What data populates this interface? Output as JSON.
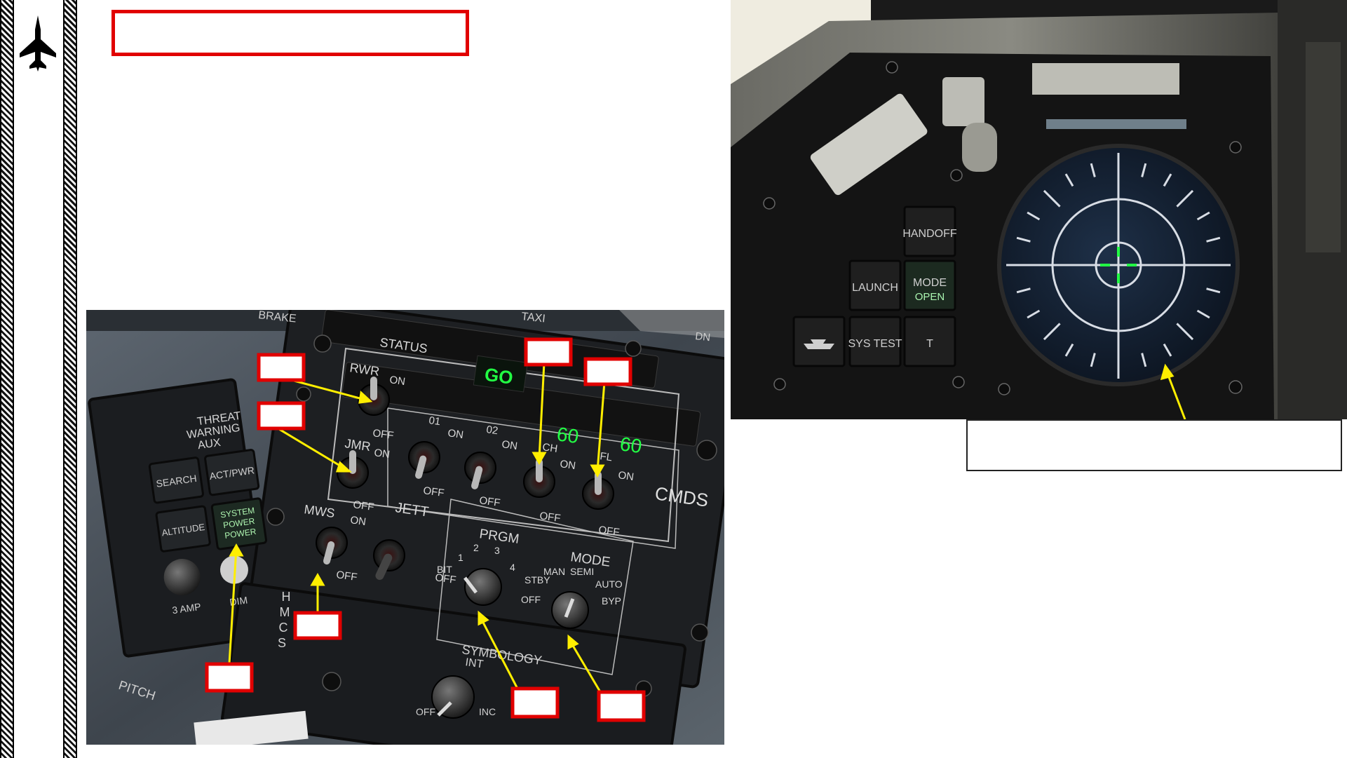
{
  "left_panel": {
    "labels": {
      "brake": "BRAKE",
      "taxi": "TAXI",
      "dn": "DN",
      "status": "STATUS",
      "status_go": "GO",
      "threat_warning_aux": [
        "THREAT",
        "WARNING",
        "AUX"
      ],
      "search": "SEARCH",
      "act_pwr": "ACT/PWR",
      "altitude": "ALTITUDE",
      "system_power": [
        "SYSTEM",
        "POWER",
        "POWER"
      ],
      "amp": "3 AMP",
      "dim": "DIM",
      "rwr": "RWR",
      "jmr": "JMR",
      "mws": "MWS",
      "on": "ON",
      "off": "OFF",
      "sw01": "01",
      "sw02": "02",
      "ch": "CH",
      "fl": "FL",
      "ch_value": "60",
      "fl_value": "60",
      "cmds": "CMDS",
      "jett": "JETT",
      "prgm": "PRGM",
      "prgm_bit": "BIT",
      "prgm_1": "1",
      "prgm_2": "2",
      "prgm_3": "3",
      "prgm_4": "4",
      "mode": "MODE",
      "mode_stby": "STBY",
      "mode_man": "MAN",
      "mode_semi": "SEMI",
      "mode_auto": "AUTO",
      "mode_byp": "BYP",
      "mode_off": "OFF",
      "hmcs": [
        "H",
        "M",
        "C",
        "S"
      ],
      "symbology": "SYMBOLOGY",
      "int": "INT",
      "inc": "INC",
      "pitch": "PITCH"
    }
  },
  "right_panel": {
    "labels": {
      "handoff": "HANDOFF",
      "launch": "LAUNCH",
      "mode": "MODE",
      "open": "OPEN",
      "sys_test": "SYS TEST",
      "t": "T"
    }
  },
  "colors": {
    "callout_border": "#e10000",
    "arrow": "#ffee00",
    "panel_text": "#d8d8d8",
    "green_display": "#22ff44"
  }
}
